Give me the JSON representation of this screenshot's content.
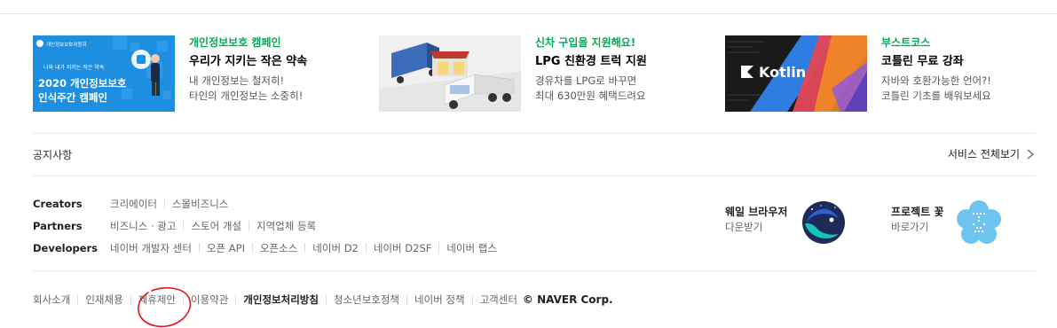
{
  "promos": [
    {
      "kicker": "개인정보보호 캠페인",
      "title": "우리가 지키는 작은 약속",
      "desc": [
        "내 개인정보는 철저히!",
        "타인의 개인정보는 소중히!"
      ],
      "thumb": {
        "org": "개인정보보호위원회",
        "tagline": "나와 내가 지키는 작은 약속",
        "headline1": "2020 개인정보보호",
        "headline2": "인식주간 캠페인",
        "bg": "#1a8ad8"
      }
    },
    {
      "kicker": "신차 구입을 지원해요!",
      "title": "LPG 친환경 트럭 지원",
      "desc": [
        "경유차를 LPG로 바꾸면",
        "최대 630만원 혜택드려요"
      ]
    },
    {
      "kicker": "부스트코스",
      "title": "코틀린 무료 강좌",
      "desc": [
        "자바와 호환가능한 언어?!",
        "코틀린 기초를 배워보세요"
      ],
      "thumb": {
        "logo_text": "Kotlin"
      }
    }
  ],
  "notice": {
    "label": "공지사항"
  },
  "all_services": {
    "label": "서비스 전체보기"
  },
  "link_rows": [
    {
      "label": "Creators",
      "items": [
        "크리에이터",
        "스몰비즈니스"
      ]
    },
    {
      "label": "Partners",
      "items": [
        "비즈니스 · 광고",
        "스토어 개설",
        "지역업체 등록"
      ]
    },
    {
      "label": "Developers",
      "items": [
        "네이버 개발자 센터",
        "오픈 API",
        "오픈소스",
        "네이버 D2",
        "네이버 D2SF",
        "네이버 랩스"
      ]
    }
  ],
  "apps": [
    {
      "title": "웨일 브라우저",
      "sub": "다운받기"
    },
    {
      "title": "프로젝트 꽃",
      "sub": "바로가기"
    }
  ],
  "footer": {
    "items": [
      "회사소개",
      "인재채용",
      "제휴제안",
      "이용약관",
      "개인정보처리방침",
      "청소년보호정책",
      "네이버 정책",
      "고객센터"
    ],
    "bold_index": 4,
    "copyright": "© NAVER Corp."
  },
  "colors": {
    "kicker": "#03aa5a",
    "annotation": "#e0141e",
    "kotlin_bg": "#1a1a1a"
  },
  "annotation": {
    "shape": "hand-drawn red circle",
    "target": "제휴제안"
  }
}
